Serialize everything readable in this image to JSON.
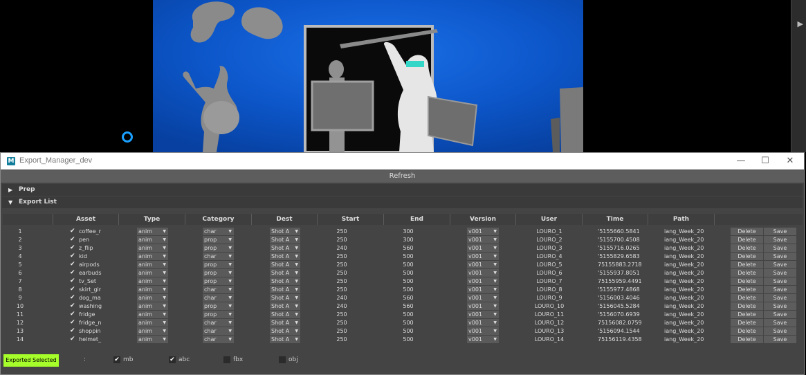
{
  "window": {
    "title": "Export_Manager_dev",
    "minimize": "—",
    "maximize": "☐",
    "close": "✕"
  },
  "refresh_label": "Refresh",
  "sections": {
    "prep": "Prep",
    "export_list": "Export List"
  },
  "columns": [
    "Asset",
    "Type",
    "Category",
    "Dest",
    "Start",
    "End",
    "Version",
    "User",
    "Time",
    "Path"
  ],
  "rows": [
    {
      "n": "1",
      "asset": "coffee_r",
      "type": "anim",
      "category": "char",
      "dest": "Shot A",
      "start": "250",
      "end": "300",
      "version": "v001",
      "user": "LOURO_1",
      "time": "'5155660.5841",
      "path": "iang_Week_20"
    },
    {
      "n": "2",
      "asset": "pen",
      "type": "anim",
      "category": "prop",
      "dest": "Shot A",
      "start": "250",
      "end": "300",
      "version": "v001",
      "user": "LOURO_2",
      "time": "'5155700.4508",
      "path": "iang_Week_20"
    },
    {
      "n": "3",
      "asset": "z_flip",
      "type": "anim",
      "category": "prop",
      "dest": "Shot A",
      "start": "240",
      "end": "560",
      "version": "v001",
      "user": "LOURO_3",
      "time": "'5155716.0265",
      "path": "iang_Week_20"
    },
    {
      "n": "4",
      "asset": "kid",
      "type": "anim",
      "category": "char",
      "dest": "Shot A",
      "start": "250",
      "end": "500",
      "version": "v001",
      "user": "LOURO_4",
      "time": "'5155829.6583",
      "path": "iang_Week_20"
    },
    {
      "n": "5",
      "asset": "airpods",
      "type": "anim",
      "category": "prop",
      "dest": "Shot A",
      "start": "250",
      "end": "500",
      "version": "v001",
      "user": "LOURO_5",
      "time": "75155883.2718",
      "path": "iang_Week_20"
    },
    {
      "n": "6",
      "asset": "earbuds",
      "type": "anim",
      "category": "prop",
      "dest": "Shot A",
      "start": "250",
      "end": "500",
      "version": "v001",
      "user": "LOURO_6",
      "time": "'5155937.8051",
      "path": "iang_Week_20"
    },
    {
      "n": "7",
      "asset": "tv_Set",
      "type": "anim",
      "category": "prop",
      "dest": "Shot A",
      "start": "250",
      "end": "500",
      "version": "v001",
      "user": "LOURO_7",
      "time": "75155959.4491",
      "path": "iang_Week_20"
    },
    {
      "n": "8",
      "asset": "skirt_gir",
      "type": "anim",
      "category": "char",
      "dest": "Shot A",
      "start": "250",
      "end": "500",
      "version": "v001",
      "user": "LOURO_8",
      "time": "'5155977.4868",
      "path": "iang_Week_20"
    },
    {
      "n": "9",
      "asset": "dog_ma",
      "type": "anim",
      "category": "char",
      "dest": "Shot A",
      "start": "240",
      "end": "560",
      "version": "v001",
      "user": "LOURO_9",
      "time": "'5156003.4046",
      "path": "iang_Week_20"
    },
    {
      "n": "10",
      "asset": "washing",
      "type": "anim",
      "category": "prop",
      "dest": "Shot A",
      "start": "240",
      "end": "560",
      "version": "v001",
      "user": "LOURO_10",
      "time": "'5156045.5284",
      "path": "iang_Week_20"
    },
    {
      "n": "11",
      "asset": "fridge",
      "type": "anim",
      "category": "prop",
      "dest": "Shot A",
      "start": "250",
      "end": "500",
      "version": "v001",
      "user": "LOURO_11",
      "time": "'5156070.6939",
      "path": "iang_Week_20"
    },
    {
      "n": "12",
      "asset": "fridge_n",
      "type": "anim",
      "category": "char",
      "dest": "Shot A",
      "start": "250",
      "end": "500",
      "version": "v001",
      "user": "LOURO_12",
      "time": "75156082.0759",
      "path": "iang_Week_20"
    },
    {
      "n": "13",
      "asset": "shoppin",
      "type": "anim",
      "category": "char",
      "dest": "Shot A",
      "start": "250",
      "end": "500",
      "version": "v001",
      "user": "LOURO_13",
      "time": "'5156094.1544",
      "path": "iang_Week_20"
    },
    {
      "n": "14",
      "asset": "helmet_",
      "type": "anim",
      "category": "char",
      "dest": "Shot A",
      "start": "250",
      "end": "500",
      "version": "v001",
      "user": "LOURO_14",
      "time": "75156119.4358",
      "path": "iang_Week_20"
    }
  ],
  "row_actions": {
    "delete": "Delete",
    "save": "Save"
  },
  "bottom": {
    "export_selected": "Exported Selected",
    "colon": ":",
    "formats": [
      {
        "label": "mb",
        "checked": true
      },
      {
        "label": "abc",
        "checked": true
      },
      {
        "label": "fbx",
        "checked": false
      },
      {
        "label": "obj",
        "checked": false
      }
    ]
  },
  "colors": {
    "accent_green": "#a6ff2a",
    "viewport_blue": "#0a55c8",
    "indicator": "#1aa0ff"
  }
}
